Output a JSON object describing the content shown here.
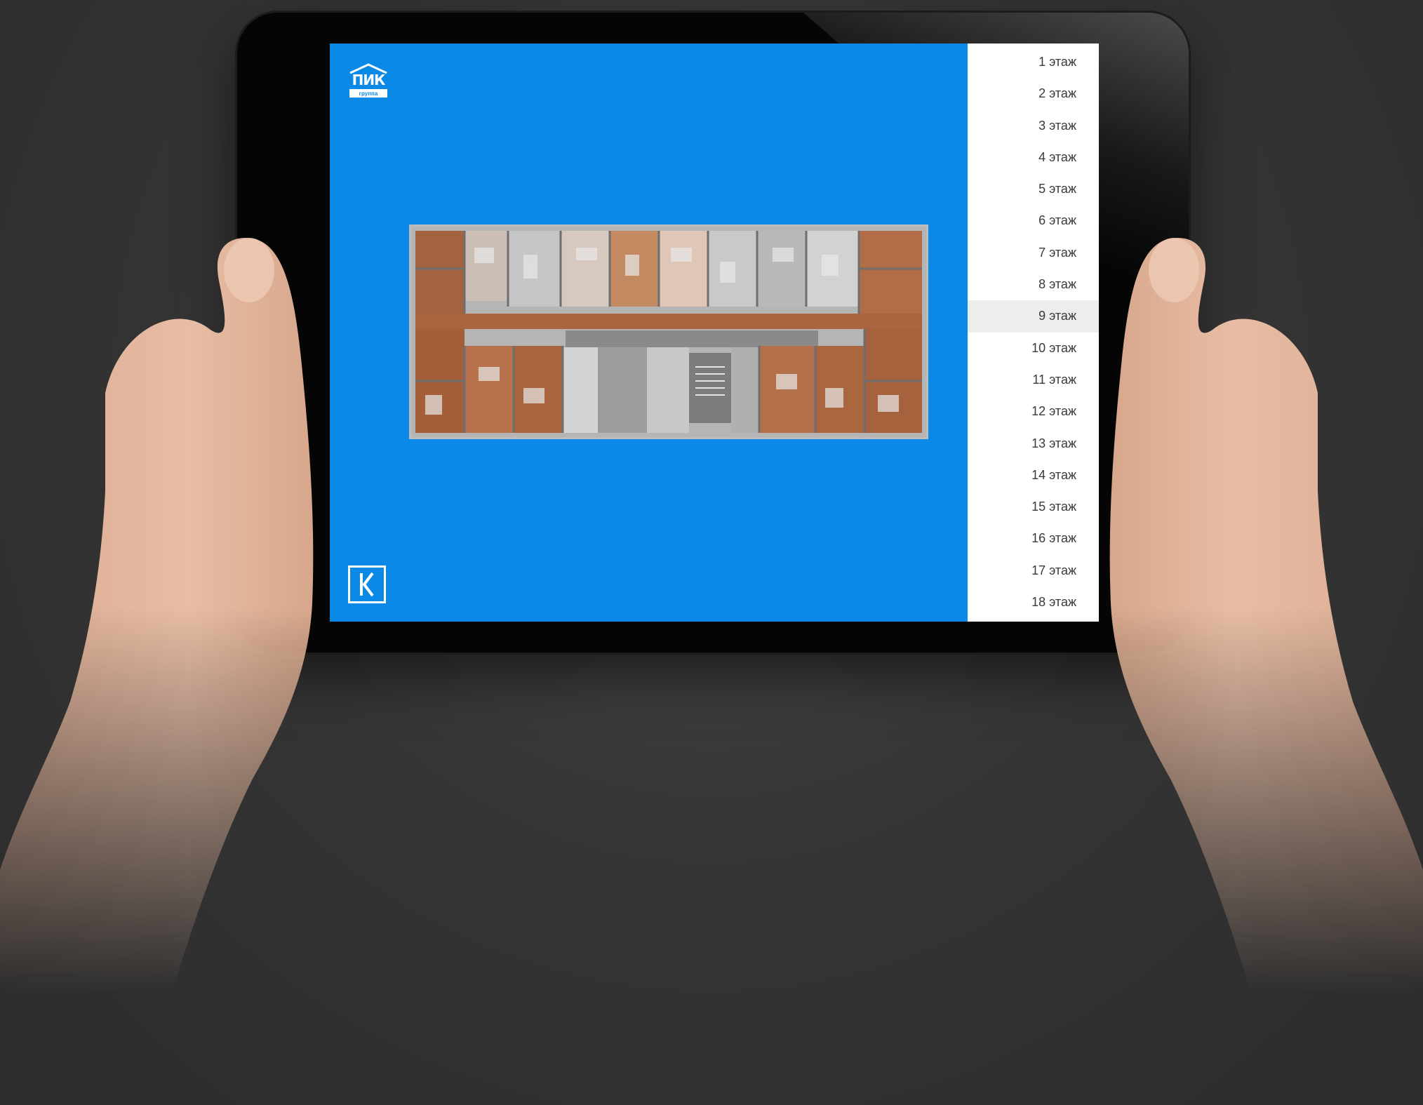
{
  "logo": {
    "word": "ПИК",
    "sub": "группа"
  },
  "floors": [
    {
      "label": "1 этаж"
    },
    {
      "label": "2 этаж"
    },
    {
      "label": "3 этаж"
    },
    {
      "label": "4 этаж"
    },
    {
      "label": "5 этаж"
    },
    {
      "label": "6 этаж"
    },
    {
      "label": "7 этаж"
    },
    {
      "label": "8 этаж"
    },
    {
      "label": "9 этаж"
    },
    {
      "label": "10 этаж"
    },
    {
      "label": "11 этаж"
    },
    {
      "label": "12 этаж"
    },
    {
      "label": "13 этаж"
    },
    {
      "label": "14 этаж"
    },
    {
      "label": "15 этаж"
    },
    {
      "label": "16 этаж"
    },
    {
      "label": "17 этаж"
    },
    {
      "label": "18 этаж"
    }
  ],
  "selected_floor": "9 этаж",
  "colors": {
    "screen_blue": "#0a89e6",
    "list_bg": "#ffffff",
    "list_active": "#ededed",
    "background": "#2e2e2e"
  },
  "icons": [
    "house-roof-icon",
    "back-icon"
  ]
}
